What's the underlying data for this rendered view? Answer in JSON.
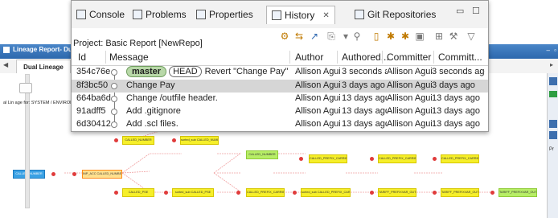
{
  "lineage": {
    "title": "Lineage Report- Dual",
    "tab_label": "Dual Lineage",
    "side_label": "al Lin age for: SYSTEM / ENVIRON",
    "right_panel_text": "Pr"
  },
  "history": {
    "tabs": [
      {
        "label": "Console",
        "icon": "console-icon"
      },
      {
        "label": "Problems",
        "icon": "problems-icon"
      },
      {
        "label": "Properties",
        "icon": "properties-icon"
      },
      {
        "label": "History",
        "icon": "history-icon",
        "active": true
      },
      {
        "label": "Git Repositories",
        "icon": "git-repositories-icon"
      }
    ],
    "project_label": "Project: Basic Report [NewRepo]",
    "columns": {
      "id": "Id",
      "message": "Message",
      "author": "Author",
      "authored": "Authored...",
      "committer": "Committer",
      "committed": "Committ..."
    },
    "rows": [
      {
        "id": "354c76e",
        "tags": [
          "master",
          "HEAD"
        ],
        "message": "Revert \"Change Pay\"",
        "author": "Allison Aguin",
        "authored": "3 seconds ago",
        "committer": "Allison Aguin",
        "committed": "3 seconds ago",
        "selected": false
      },
      {
        "id": "8f3bc50",
        "tags": [],
        "message": "Change Pay",
        "author": "Allison Aguin",
        "authored": "3 days ago",
        "committer": "Allison Aguin",
        "committed": "3 days ago",
        "selected": true
      },
      {
        "id": "664ba6d",
        "tags": [],
        "message": "Change /outfile header.",
        "author": "Allison Aguin",
        "authored": "13 days ago",
        "committer": "Allison Aguin",
        "committed": "13 days ago",
        "selected": false
      },
      {
        "id": "91adff5",
        "tags": [],
        "message": "Add .gitignore",
        "author": "Allison Aguin",
        "authored": "13 days ago",
        "committer": "Allison Aguin",
        "committed": "13 days ago",
        "selected": false
      },
      {
        "id": "6d30412",
        "tags": [],
        "message": "Add .scl files.",
        "author": "Allison Aguin",
        "authored": "13 days ago",
        "committer": "Allison Aguin",
        "committed": "13 days ago",
        "selected": false
      }
    ]
  },
  "nodes": {
    "n1": "CALLED_NUMBER",
    "n2": "CALLED_NUMBER",
    "n3": "CALLED_NUMBER",
    "n4": "CALLED_NUMBER",
    "n5": "sorted_sub CALLED_NUMBER",
    "n6": "CALLED_NUMBER",
    "n7": "CALLED_PREFIX_CARRIER",
    "n8": "CALLED_PREFIX_CARRIER",
    "n9": "CALLED_PREFIX_CARRIER",
    "n10": "CALLED_NUMBER",
    "n11": "INP_ACC CALLED_NUMBER",
    "n12": "CALLED_PSE",
    "n13": "sorted_sub CALLED_PSE",
    "n14": "CALLED_PREFIX_CARRIER",
    "n15": "sorted_sub CALLED_PREFIX_CARRIER",
    "n16": "TARIFF_PREFIXVAR_OUT",
    "n17": "TARIFF_PREFIXVAR_OUT",
    "n18": "TARIFF_PREFIXVAR_OUT"
  }
}
